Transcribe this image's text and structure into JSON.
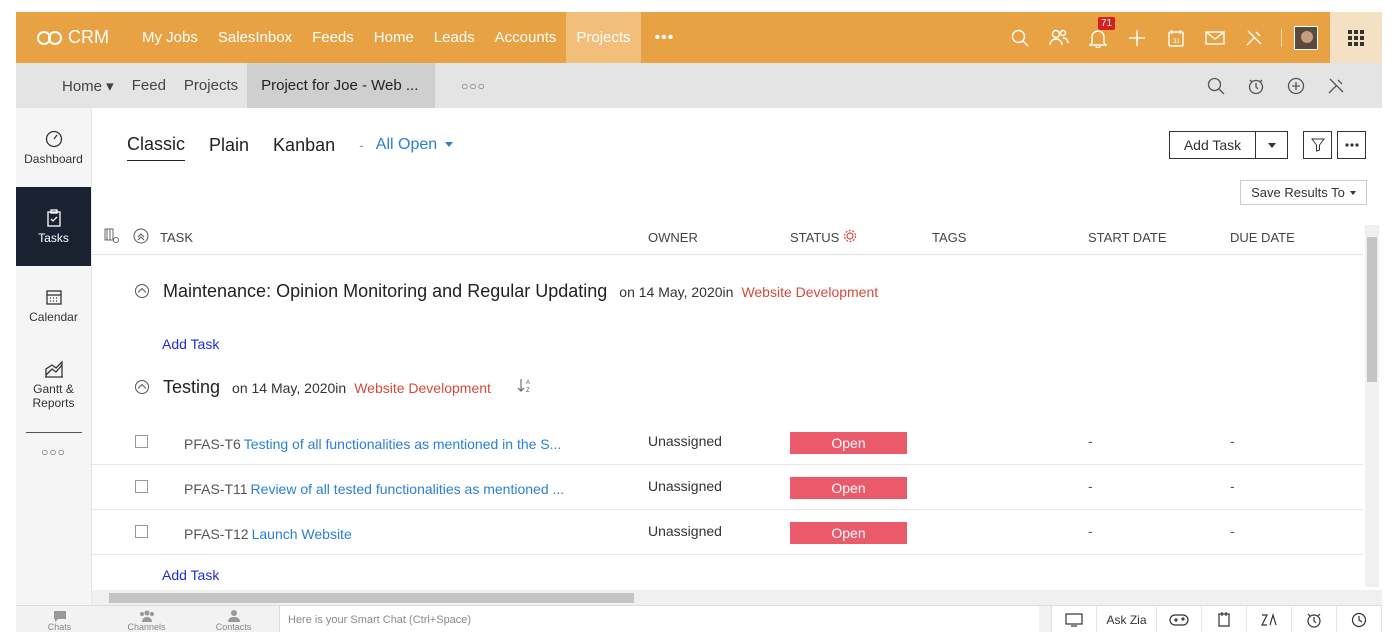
{
  "brand": {
    "name": "CRM"
  },
  "topnav": {
    "items": [
      {
        "label": "My Jobs"
      },
      {
        "label": "SalesInbox"
      },
      {
        "label": "Feeds"
      },
      {
        "label": "Home"
      },
      {
        "label": "Leads"
      },
      {
        "label": "Accounts"
      },
      {
        "label": "Projects",
        "active": true
      }
    ],
    "more": "•••",
    "notification_count": "71"
  },
  "subnav": {
    "items": [
      {
        "label": "Home ▾"
      },
      {
        "label": "Feed"
      },
      {
        "label": "Projects"
      },
      {
        "label": "Project for Joe - Web ...",
        "active": true
      }
    ],
    "more": "○○○"
  },
  "sidebar": {
    "items": [
      {
        "label": "Dashboard",
        "icon": "speedometer-icon"
      },
      {
        "label": "Tasks",
        "icon": "clipboard-check-icon",
        "active": true
      },
      {
        "label": "Calendar",
        "icon": "calendar-icon"
      },
      {
        "label": "Gantt &",
        "label2": "Reports",
        "icon": "chart-icon"
      }
    ],
    "more": "○○○"
  },
  "views": {
    "tabs": [
      {
        "label": "Classic",
        "active": true
      },
      {
        "label": "Plain"
      },
      {
        "label": "Kanban"
      }
    ],
    "separator": "-",
    "filter": "All Open"
  },
  "toolbar": {
    "add_task": "Add Task",
    "save_results": "Save Results To"
  },
  "table": {
    "columns": {
      "task": "TASK",
      "owner": "OWNER",
      "status": "STATUS",
      "tags": "TAGS",
      "start_date": "START DATE",
      "due_date": "DUE DATE"
    }
  },
  "groups": [
    {
      "name": "Maintenance: Opinion Monitoring and Regular Updating",
      "date": "on 14 May, 2020in",
      "project": "Website Development",
      "add_task": "Add Task"
    },
    {
      "name": "Testing",
      "date": "on 14 May, 2020in",
      "project": "Website Development",
      "add_task": "Add Task",
      "tasks": [
        {
          "id": "PFAS-T6",
          "name": "Testing of all functionalities as mentioned in the S...",
          "owner": "Unassigned",
          "status": "Open",
          "start": "-",
          "due": "-"
        },
        {
          "id": "PFAS-T11",
          "name": "Review of all tested functionalities as mentioned ...",
          "owner": "Unassigned",
          "status": "Open",
          "start": "-",
          "due": "-"
        },
        {
          "id": "PFAS-T12",
          "name": "Launch Website",
          "owner": "Unassigned",
          "status": "Open",
          "start": "-",
          "due": "-"
        }
      ]
    }
  ],
  "bottombar": {
    "chats": "Chats",
    "channels": "Channels",
    "contacts": "Contacts",
    "smart_chat_placeholder": "Here is your Smart Chat (Ctrl+Space)",
    "ask_zia": "Ask Zia"
  },
  "colors": {
    "topbar": "#e9a243",
    "active_nav": "#f1bf7a",
    "status_open": "#ea5a6a",
    "link": "#2b7fd6",
    "project_link": "#d44a3a",
    "sidebar_active": "#1a2232"
  }
}
